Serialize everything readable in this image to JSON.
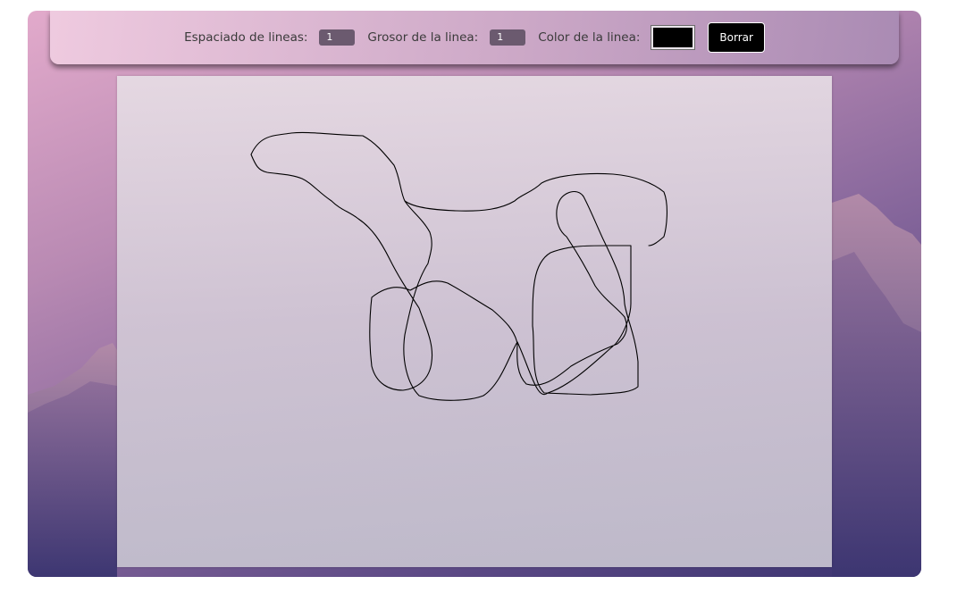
{
  "toolbar": {
    "spacing_label": "Espaciado de lineas:",
    "spacing_value": "1",
    "thickness_label": "Grosor de la linea:",
    "thickness_value": "1",
    "color_label": "Color de la linea:",
    "color_value": "#000000",
    "clear_label": "Borrar"
  },
  "canvas": {
    "stroke_color": "#000000"
  },
  "colors": {
    "background_top": "#e2aacb",
    "background_bottom": "#3a3370",
    "button_bg": "#000000"
  }
}
